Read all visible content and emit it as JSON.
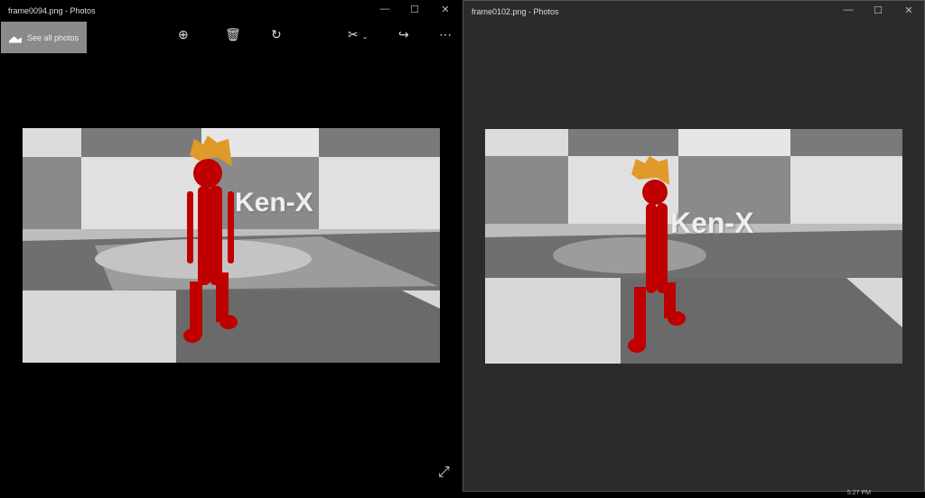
{
  "windows": [
    {
      "title": "frame0094.png - Photos",
      "toolbar": {
        "see_all_photos": "See all photos",
        "zoom": "zoom-in-icon",
        "delete": "delete-icon",
        "rotate": "rotate-icon",
        "edit": "edit-icon",
        "share": "share-icon",
        "more": "⋯"
      },
      "image_text": "Ken-X",
      "bg": "#000000"
    },
    {
      "title": "frame0102.png - Photos",
      "image_text": "Ken-X",
      "bg": "#2b2b2b"
    }
  ],
  "controls": {
    "minimize": "—",
    "maximize": "☐",
    "close": "✕"
  },
  "taskbar": {
    "time": "5:27 PM"
  }
}
